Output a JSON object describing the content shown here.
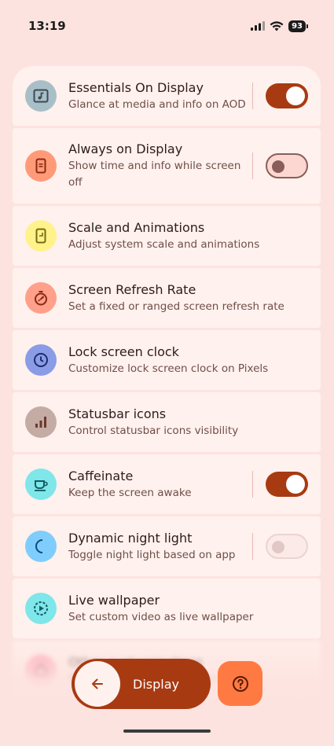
{
  "status": {
    "time": "13:19",
    "battery": "93"
  },
  "items": [
    {
      "title": "Essentials On Display",
      "subtitle": "Glance at media and info on AOD",
      "icon": "music-display-icon",
      "icon_bg": "#a9bfc8",
      "icon_fg": "#3b4a52",
      "toggle": "on"
    },
    {
      "title": "Always on Display",
      "subtitle": "Show time and info while screen off",
      "icon": "phone-display-icon",
      "icon_bg": "#ff9a78",
      "icon_fg": "#8b2a10",
      "toggle": "off"
    },
    {
      "title": "Scale and Animations",
      "subtitle": "Adjust system scale and animations",
      "icon": "phone-scale-icon",
      "icon_bg": "#fff28a",
      "icon_fg": "#7a6a10",
      "toggle": null
    },
    {
      "title": "Screen Refresh Rate",
      "subtitle": "Set a fixed or ranged screen refresh rate",
      "icon": "timer-icon",
      "icon_bg": "#ffa08a",
      "icon_fg": "#8b2a10",
      "toggle": null
    },
    {
      "title": "Lock screen clock",
      "subtitle": "Customize lock screen clock on Pixels",
      "icon": "clock-icon",
      "icon_bg": "#8a9ce6",
      "icon_fg": "#1e2c70",
      "toggle": null
    },
    {
      "title": "Statusbar icons",
      "subtitle": "Control statusbar icons visibility",
      "icon": "signal-bars-icon",
      "icon_bg": "#c4aca5",
      "icon_fg": "#6a3a2c",
      "toggle": null
    },
    {
      "title": "Caffeinate",
      "subtitle": "Keep the screen awake",
      "icon": "coffee-cup-icon",
      "icon_bg": "#7fe6ea",
      "icon_fg": "#0f5c62",
      "toggle": "on"
    },
    {
      "title": "Dynamic night light",
      "subtitle": "Toggle night light based on app",
      "icon": "moon-icon",
      "icon_bg": "#7fcdfc",
      "icon_fg": "#0d4a78",
      "toggle": "off-disabled"
    },
    {
      "title": "Live wallpaper",
      "subtitle": "Set custom video as live wallpaper",
      "icon": "play-circle-icon",
      "icon_bg": "#7fe6ea",
      "icon_fg": "#0f5c62",
      "toggle": null
    },
    {
      "title": "Other customizations",
      "subtitle": "Extra display customizations",
      "icon": "home-icon",
      "icon_bg": "#ffa0b8",
      "icon_fg": "#8a1f40",
      "toggle": null
    }
  ],
  "bottom": {
    "label": "Display"
  },
  "colors": {
    "accent": "#a83a12",
    "help": "#ff7a42",
    "background": "#fde3df"
  }
}
